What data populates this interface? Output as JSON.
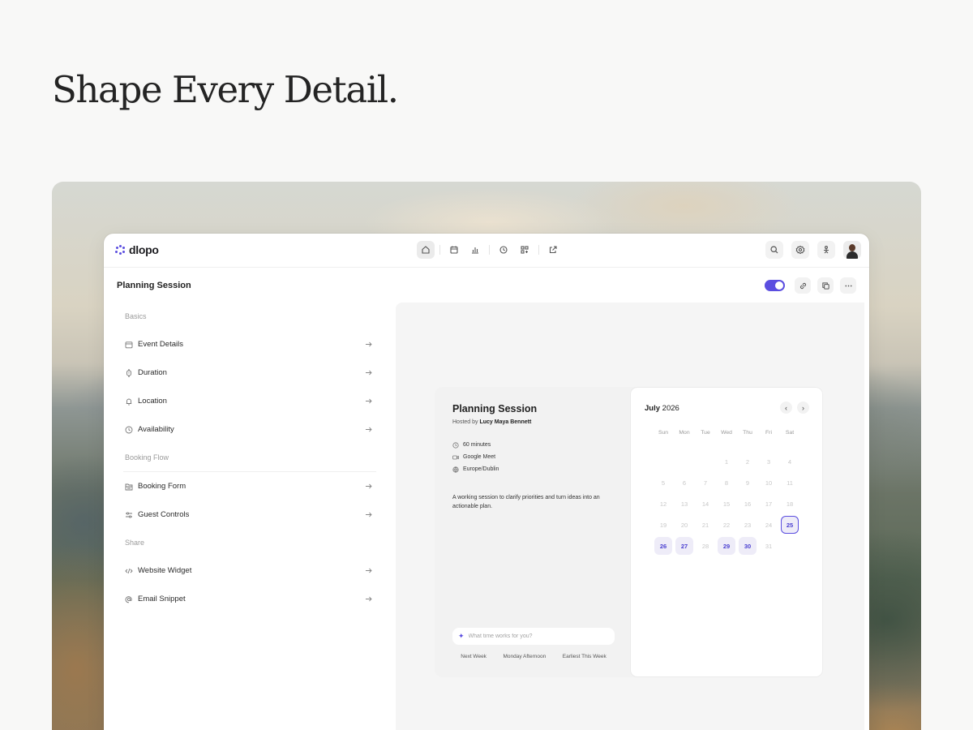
{
  "hero": {
    "title": "Shape Every Detail."
  },
  "app": {
    "logo": "dlopo",
    "page_title": "Planning Session",
    "nav_center": [
      {
        "icon": "home-icon",
        "active": true
      },
      {
        "icon": "calendar-icon",
        "active": false
      },
      {
        "icon": "chart-icon",
        "active": false
      },
      {
        "icon": "clock-icon",
        "active": false
      },
      {
        "icon": "apps-icon",
        "active": false
      },
      {
        "icon": "external-link-icon",
        "active": false
      }
    ],
    "nav_right": [
      "search-icon",
      "settings-icon",
      "share-icon",
      "avatar"
    ],
    "title_actions": {
      "enabled": true,
      "icons": [
        "link-icon",
        "copy-icon",
        "more-icon"
      ]
    }
  },
  "sidebar": {
    "sections": [
      {
        "label": "Basics",
        "items": [
          {
            "label": "Event Details",
            "icon": "calendar-icon"
          },
          {
            "label": "Duration",
            "icon": "watch-icon"
          },
          {
            "label": "Location",
            "icon": "bell-icon"
          },
          {
            "label": "Availability",
            "icon": "clock-icon"
          }
        ]
      },
      {
        "label": "Booking Flow",
        "items": [
          {
            "label": "Booking Form",
            "icon": "form-icon"
          },
          {
            "label": "Guest Controls",
            "icon": "sliders-icon"
          }
        ]
      },
      {
        "label": "Share",
        "items": [
          {
            "label": "Website Widget",
            "icon": "code-icon"
          },
          {
            "label": "Email Snippet",
            "icon": "at-icon"
          }
        ]
      }
    ]
  },
  "booking": {
    "title": "Planning Session",
    "host_prefix": "Hosted by",
    "host_name": "Lucy Maya Bennett",
    "meta": [
      {
        "icon": "clock-icon",
        "text": "60 minutes"
      },
      {
        "icon": "video-icon",
        "text": "Google Meet"
      },
      {
        "icon": "globe-icon",
        "text": "Europe/Dublin"
      }
    ],
    "description": "A working session to clarify priorities and turn ideas into an actionable plan.",
    "ask_placeholder": "What time works for you?",
    "chips": [
      "Next Week",
      "Monday Afternoon",
      "Earliest This Week"
    ]
  },
  "calendar": {
    "month": "July",
    "year": "2026",
    "weekdays": [
      "Sun",
      "Mon",
      "Tue",
      "Wed",
      "Thu",
      "Fri",
      "Sat"
    ],
    "leading_blanks": 3,
    "days_in_month": 31,
    "available": [
      26,
      27,
      29,
      30
    ],
    "selected": 25
  },
  "colors": {
    "accent": "#5b4ee0",
    "accent_soft": "#eeecf8"
  }
}
